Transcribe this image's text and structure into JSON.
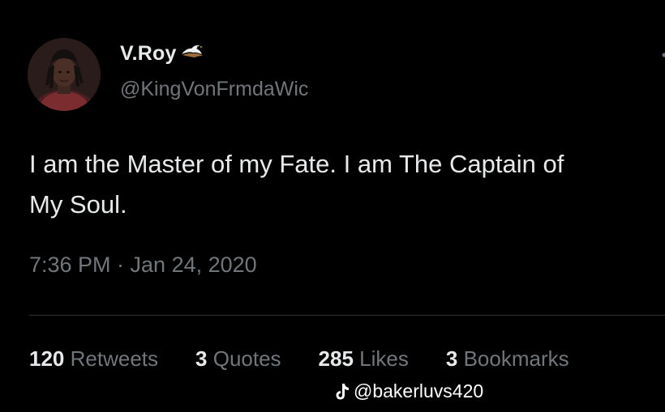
{
  "author": {
    "display_name": "V.Roy",
    "badge_icon": "eagle-icon",
    "handle": "@KingVonFrmdaWic",
    "avatar_icon": "avatar-photo"
  },
  "tweet": {
    "line1": "I am the Master of my Fate. I am The Captain of",
    "line2": "My Soul.",
    "timestamp": "7:36 PM · Jan 24, 2020"
  },
  "stats": [
    {
      "count": "120",
      "label": "Retweets"
    },
    {
      "count": "3",
      "label": "Quotes"
    },
    {
      "count": "285",
      "label": "Likes"
    },
    {
      "count": "3",
      "label": "Bookmarks"
    }
  ],
  "watermark": {
    "icon": "tiktok-icon",
    "text": "@bakerluvs420"
  },
  "colors": {
    "background": "#000000",
    "primary_text": "#e7e9ea",
    "secondary_text": "#71767b",
    "divider": "#2f3336"
  }
}
